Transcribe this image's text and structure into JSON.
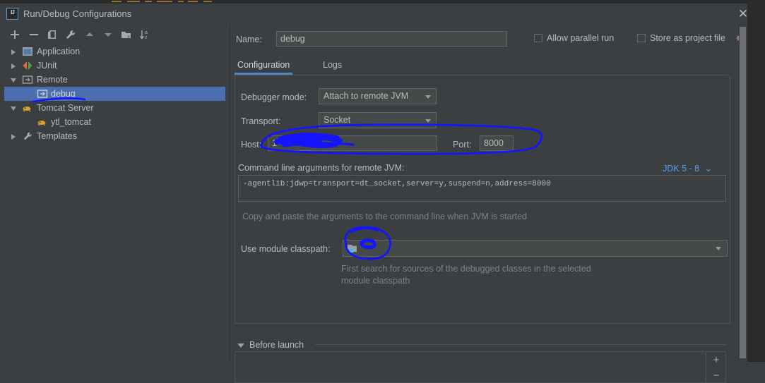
{
  "window": {
    "title": "Run/Debug Configurations",
    "app_icon": "intellij-idea-icon",
    "close_label": "✕"
  },
  "toolbar": {
    "buttons": [
      {
        "name": "add-configuration-button",
        "icon": "plus-icon",
        "tooltip": "Add New Configuration"
      },
      {
        "name": "remove-configuration-button",
        "icon": "minus-icon",
        "tooltip": "Remove Configuration"
      },
      {
        "name": "copy-configuration-button",
        "icon": "copy-icon",
        "tooltip": "Copy Configuration"
      },
      {
        "name": "edit-templates-button",
        "icon": "wrench-icon",
        "tooltip": "Edit Templates"
      },
      {
        "name": "move-up-button",
        "icon": "arrow-up-icon",
        "tooltip": "Move Up"
      },
      {
        "name": "move-down-button",
        "icon": "arrow-down-icon",
        "tooltip": "Move Down"
      },
      {
        "name": "create-folder-button",
        "icon": "folder-add-icon",
        "tooltip": "Create New Folder"
      },
      {
        "name": "sort-configurations-button",
        "icon": "sort-az-icon",
        "tooltip": "Sort Configurations"
      }
    ]
  },
  "tree": {
    "items": [
      {
        "label": "Application",
        "level": 0,
        "expanded": false,
        "icon": "application-icon",
        "selected": false
      },
      {
        "label": "JUnit",
        "level": 0,
        "expanded": false,
        "icon": "junit-icon",
        "selected": false
      },
      {
        "label": "Remote",
        "level": 0,
        "expanded": true,
        "icon": "remote-icon",
        "selected": false
      },
      {
        "label": "debug",
        "level": 1,
        "expanded": null,
        "icon": "remote-icon",
        "selected": true
      },
      {
        "label": "Tomcat Server",
        "level": 0,
        "expanded": true,
        "icon": "tomcat-icon",
        "selected": false
      },
      {
        "label": "ytl_tomcat",
        "level": 1,
        "expanded": null,
        "icon": "tomcat-icon",
        "selected": false
      },
      {
        "label": "Templates",
        "level": 0,
        "expanded": false,
        "icon": "wrench-icon",
        "selected": false
      }
    ]
  },
  "form": {
    "name_label": "Name:",
    "name_value": "debug",
    "allow_parallel_run": {
      "label": "Allow parallel run",
      "checked": false
    },
    "store_as_project_file": {
      "label": "Store as project file",
      "checked": false
    },
    "settings_gear": "gear-icon"
  },
  "tabs": [
    {
      "label": "Configuration",
      "active": true
    },
    {
      "label": "Logs",
      "active": false
    }
  ],
  "configuration": {
    "debugger_mode_label": "Debugger mode:",
    "debugger_mode_value": "Attach to remote JVM",
    "transport_label": "Transport:",
    "transport_value": "Socket",
    "host_label": "Host:",
    "host_value": "1",
    "port_label": "Port:",
    "port_value": "8000",
    "cmd_args_label": "Command line arguments for remote JVM:",
    "jdk_selector": "JDK 5 - 8",
    "cmd_args_value": "-agentlib:jdwp=transport=dt_socket,server=y,suspend=n,address=8000",
    "cmd_args_hint": "Copy and paste the arguments to the command line when JVM is started",
    "module_classpath_label": "Use module classpath:",
    "module_classpath_value": "",
    "module_classpath_icon": "module-icon",
    "module_classpath_hint_line1": "First search for sources of the debugged classes in the selected",
    "module_classpath_hint_line2": "module classpath"
  },
  "before_launch": {
    "label": "Before launch",
    "expanded": true,
    "add_button": "+",
    "remove_button": "−",
    "items": []
  },
  "colors": {
    "dialog_bg": "#3c3f41",
    "selection_blue": "#4b6eaf",
    "tab_underline": "#4a88c7",
    "link_blue": "#589df6",
    "annotation_blue": "#1414ff",
    "field_bg": "#45494a",
    "text": "#bbbbbb",
    "text_dim": "#808080"
  },
  "annotations": {
    "note": "hand-drawn blue marker overlay",
    "color": "#1414ff",
    "shapes": [
      "underline-under-debug-tree-item",
      "scribble-redaction-over-host-field",
      "ellipse-around-host-and-port-row",
      "ellipse-around-module-classpath-icon"
    ]
  }
}
